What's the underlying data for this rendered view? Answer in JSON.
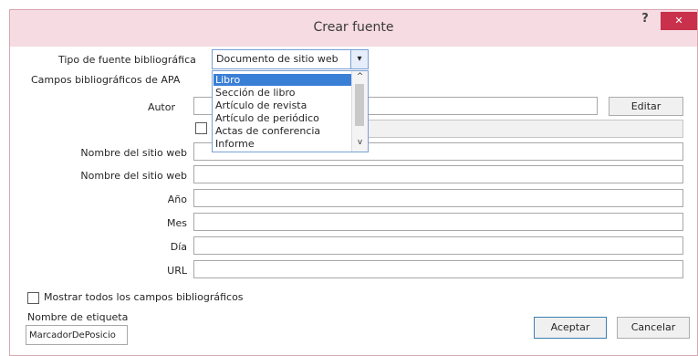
{
  "window": {
    "title": "Crear fuente",
    "help_label": "?",
    "close_label": "✕"
  },
  "source_type": {
    "label": "Tipo de fuente bibliográfica",
    "selected": "Documento de sitio web",
    "arrow": "▾"
  },
  "dropdown": {
    "items": [
      "Libro",
      "Sección de libro",
      "Artículo de revista",
      "Artículo de periódico",
      "Actas de conferencia",
      "Informe"
    ],
    "highlighted": "Libro",
    "scroll_up": "^",
    "scroll_down": "v"
  },
  "fields_section": {
    "label": "Campos bibliográficos de APA"
  },
  "fields": {
    "autor_label": "Autor",
    "editar_label": "Editar",
    "nombre_sitio_1_label": "Nombre del sitio web",
    "nombre_sitio_2_label": "Nombre del sitio web",
    "anio_label": "Año",
    "mes_label": "Mes",
    "dia_label": "Día",
    "url_label": "URL"
  },
  "show_all": {
    "label": "Mostrar todos los campos bibliográficos"
  },
  "tag": {
    "label": "Nombre de etiqueta",
    "value": "MarcadorDePosicio"
  },
  "actions": {
    "accept_label": "Aceptar",
    "cancel_label": "Cancelar"
  },
  "colors": {
    "titlebar": "#f6dbe3",
    "close_button": "#c8304b",
    "selection": "#3a7fd6"
  }
}
